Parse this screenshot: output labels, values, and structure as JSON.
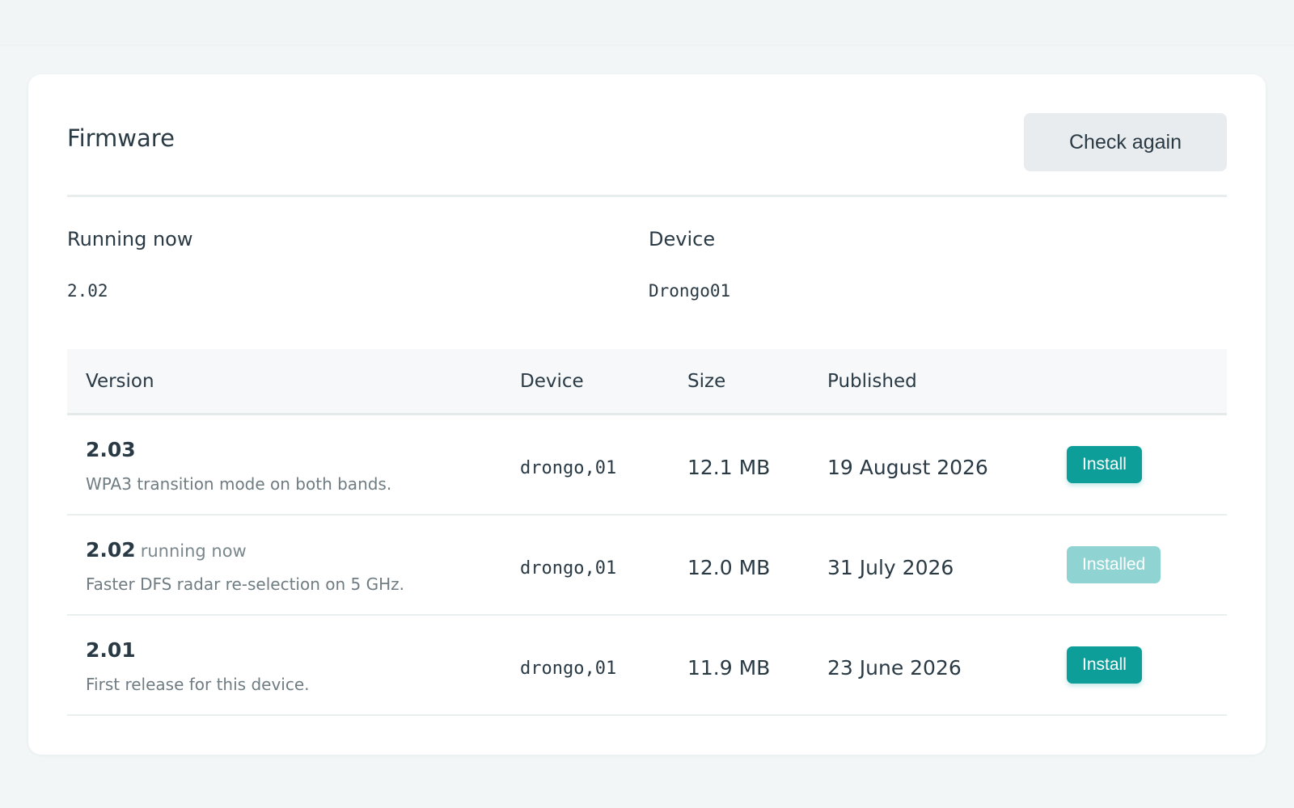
{
  "firmware": {
    "title": "Firmware",
    "check_again_label": "Check again"
  },
  "summary": {
    "running_now_label": "Running now",
    "running_now_value": "2.02",
    "device_label": "Device",
    "device_value": "Drongo01"
  },
  "table": {
    "headers": {
      "version": "Version",
      "device": "Device",
      "size": "Size",
      "published": "Published"
    },
    "rows": [
      {
        "version": "2.03",
        "note": "",
        "description": "WPA3 transition mode on both bands.",
        "device": "drongo,01",
        "size": "12.1 MB",
        "published": "19 August 2026",
        "action": "Install",
        "action_enabled": true
      },
      {
        "version": "2.02",
        "note": "running now",
        "description": "Faster DFS radar re-selection on 5 GHz.",
        "device": "drongo,01",
        "size": "12.0 MB",
        "published": "31 July 2026",
        "action": "Installed",
        "action_enabled": false
      },
      {
        "version": "2.01",
        "note": "",
        "description": "First release for this device.",
        "device": "drongo,01",
        "size": "11.9 MB",
        "published": "23 June 2026",
        "action": "Install",
        "action_enabled": true
      }
    ]
  },
  "colors": {
    "accent": "#0d9e9a",
    "accent_disabled": "#8fd4d2",
    "page_background": "#f2f6f6",
    "text": "#2a3a45",
    "muted_text": "#6f7c82"
  }
}
